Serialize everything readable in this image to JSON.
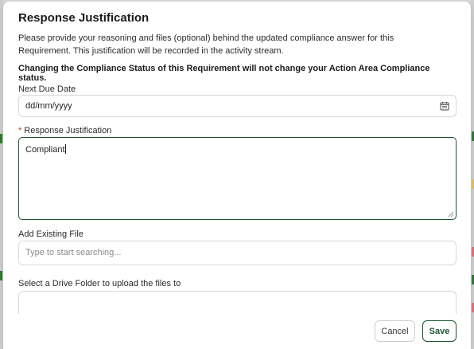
{
  "dialog": {
    "title": "Response Justification",
    "intro": "Please provide your reasoning and files (optional) behind the updated compliance answer for this Requirement. This justification will be recorded in the activity stream.",
    "warning": "Changing the Compliance Status of this Requirement will not change your Action Area Compliance status."
  },
  "due_date": {
    "label": "Next Due Date",
    "value": "dd/mm/yyyy",
    "icon": "calendar-icon"
  },
  "justification": {
    "required_marker": "*",
    "label": "Response Justification",
    "value": "Compliant"
  },
  "existing_file": {
    "label": "Add Existing File",
    "placeholder": "Type to start searching..."
  },
  "drive_folder": {
    "label": "Select a Drive Folder to upload the files to",
    "value": ""
  },
  "actions": {
    "cancel_label": "Cancel",
    "save_label": "Save"
  },
  "colors": {
    "accent": "#1e5631",
    "required": "#d93025"
  }
}
